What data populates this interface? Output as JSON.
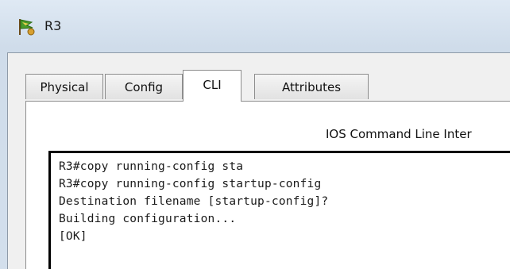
{
  "window": {
    "title": "R3",
    "icon": "router-device-icon"
  },
  "tabs": [
    {
      "label": "Physical",
      "active": false
    },
    {
      "label": "Config",
      "active": false
    },
    {
      "label": "CLI",
      "active": true
    },
    {
      "label": "Attributes",
      "active": false
    }
  ],
  "panel": {
    "heading": "IOS Command Line Inter"
  },
  "console": {
    "lines": [
      "R3#copy running-config sta",
      "R3#copy running-config startup-config",
      "Destination filename [startup-config]?",
      "Building configuration...",
      "[OK]"
    ]
  }
}
